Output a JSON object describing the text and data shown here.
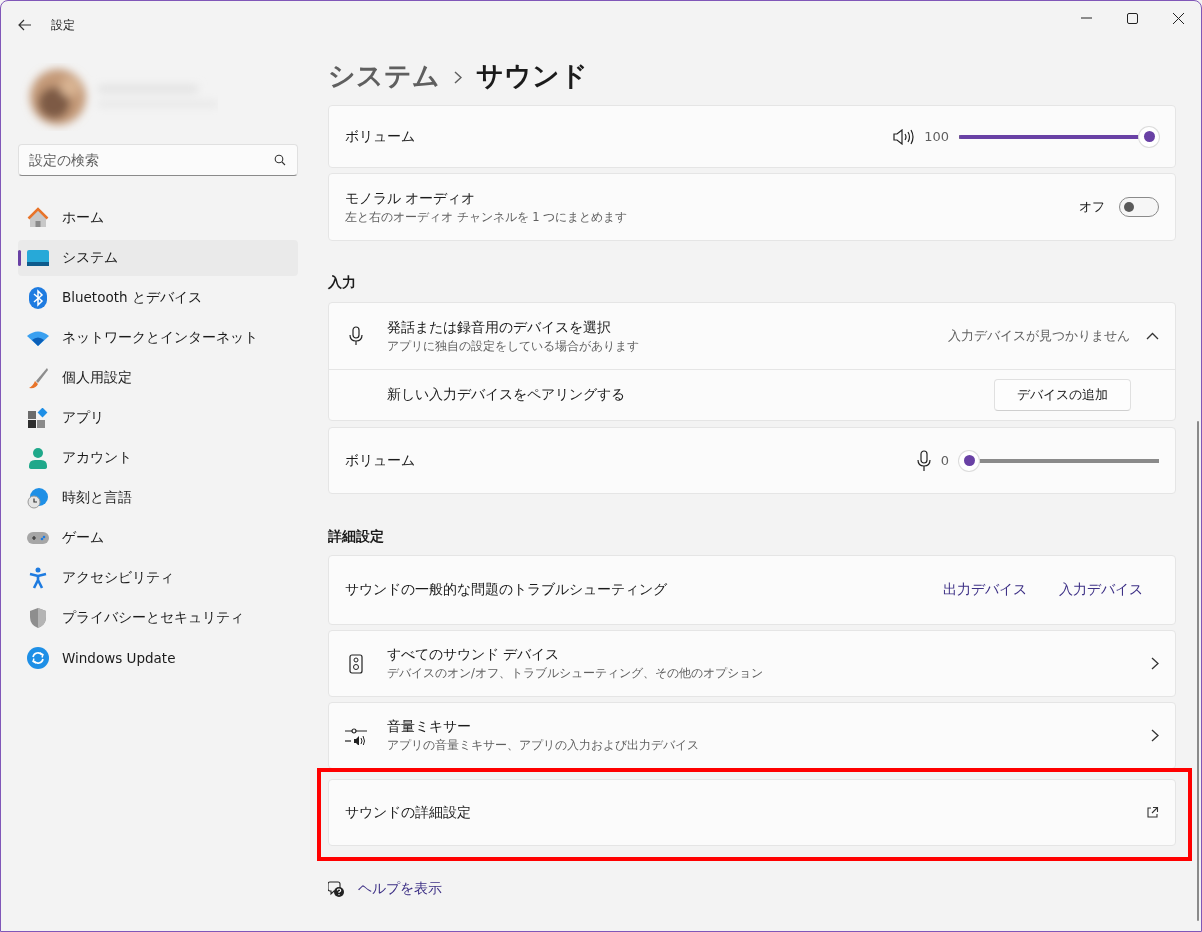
{
  "window": {
    "title": "設定"
  },
  "search": {
    "placeholder": "設定の検索"
  },
  "nav": [
    {
      "label": "ホーム",
      "kind": "home",
      "selected": false
    },
    {
      "label": "システム",
      "kind": "system",
      "selected": true
    },
    {
      "label": "Bluetooth とデバイス",
      "kind": "bluetooth",
      "selected": false
    },
    {
      "label": "ネットワークとインターネット",
      "kind": "wifi",
      "selected": false
    },
    {
      "label": "個人用設定",
      "kind": "brush",
      "selected": false
    },
    {
      "label": "アプリ",
      "kind": "apps",
      "selected": false
    },
    {
      "label": "アカウント",
      "kind": "account",
      "selected": false
    },
    {
      "label": "時刻と言語",
      "kind": "time",
      "selected": false
    },
    {
      "label": "ゲーム",
      "kind": "game",
      "selected": false
    },
    {
      "label": "アクセシビリティ",
      "kind": "access",
      "selected": false
    },
    {
      "label": "プライバシーとセキュリティ",
      "kind": "shield",
      "selected": false
    },
    {
      "label": "Windows Update",
      "kind": "update",
      "selected": false
    }
  ],
  "breadcrumb": {
    "parent": "システム",
    "current": "サウンド"
  },
  "output_volume": {
    "label": "ボリューム",
    "reading": "100",
    "level": 1.0
  },
  "mono": {
    "title": "モノラル オーディオ",
    "subtitle": "左と右のオーディオ チャンネルを 1 つにまとめます",
    "state_label": "オフ",
    "on": false
  },
  "input": {
    "heading": "入力",
    "device": {
      "title": "発話または録音用のデバイスを選択",
      "subtitle": "アプリに独自の設定をしている場合があります",
      "status": "入力デバイスが見つかりません",
      "expanded": true
    },
    "pair": {
      "label": "新しい入力デバイスをペアリングする",
      "button": "デバイスの追加"
    }
  },
  "input_volume": {
    "label": "ボリューム",
    "reading": "0",
    "level": 0
  },
  "advanced": {
    "heading": "詳細設定",
    "troubleshoot": {
      "label": "サウンドの一般的な問題のトラブルシューティング",
      "links": [
        "出力デバイス",
        "入力デバイス"
      ]
    },
    "rows": [
      {
        "kind": "speaker",
        "title": "すべてのサウンド デバイス",
        "subtitle": "デバイスのオン/オフ、トラブルシューティング、その他のオプション"
      },
      {
        "kind": "mixer",
        "title": "音量ミキサー",
        "subtitle": "アプリの音量ミキサー、アプリの入力および出力デバイス"
      }
    ],
    "more": {
      "label": "サウンドの詳細設定",
      "highlighted": true
    }
  },
  "help": {
    "label": "ヘルプを表示"
  }
}
